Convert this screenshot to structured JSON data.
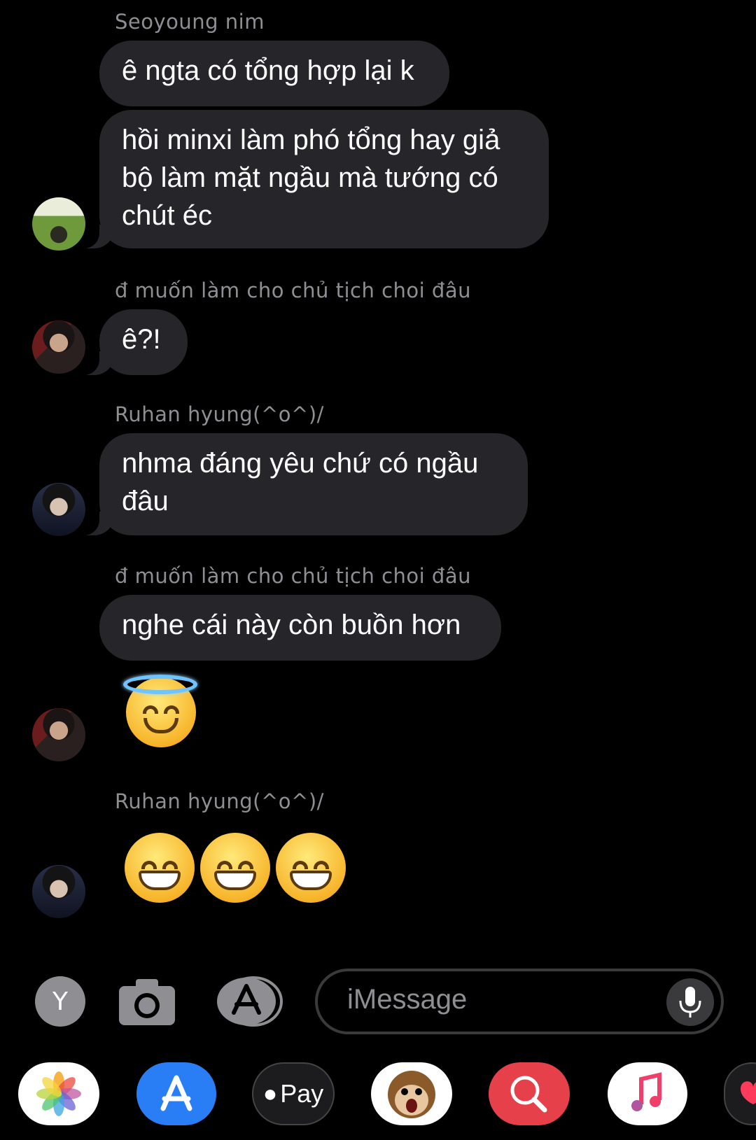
{
  "messages": [
    {
      "sender": "Seoyoung nim",
      "bubbles": [
        "ê ngta có tổng hợp lại k",
        "hồi minxi làm phó tổng hay giả bộ làm mặt ngầu mà tướng có chút éc"
      ]
    },
    {
      "sender": "đ muốn làm cho chủ tịch choi đâu",
      "bubbles": [
        "ê?!"
      ]
    },
    {
      "sender": "Ruhan hyung(^o^)/",
      "bubbles": [
        "nhma đáng yêu chứ có ngầu đâu"
      ]
    },
    {
      "sender": "đ muốn làm cho chủ tịch choi đâu",
      "bubbles": [
        "nghe cái này còn buồn hơn"
      ],
      "emoji": [
        "smiling-face-with-halo"
      ]
    },
    {
      "sender": "Ruhan hyung(^o^)/",
      "emoji": [
        "grinning-face",
        "grinning-face",
        "grinning-face"
      ]
    }
  ],
  "composer": {
    "avatar_initial": "Y",
    "placeholder": "iMessage"
  },
  "app_tray": {
    "pay_label": "Pay",
    "apps": [
      "photos-icon",
      "app-store-icon",
      "apple-pay-icon",
      "animoji-icon",
      "image-search-icon",
      "music-icon",
      "digital-touch-icon"
    ]
  },
  "colors": {
    "background": "#000000",
    "bubble": "#26252a",
    "sender_text": "#8e8e93"
  }
}
